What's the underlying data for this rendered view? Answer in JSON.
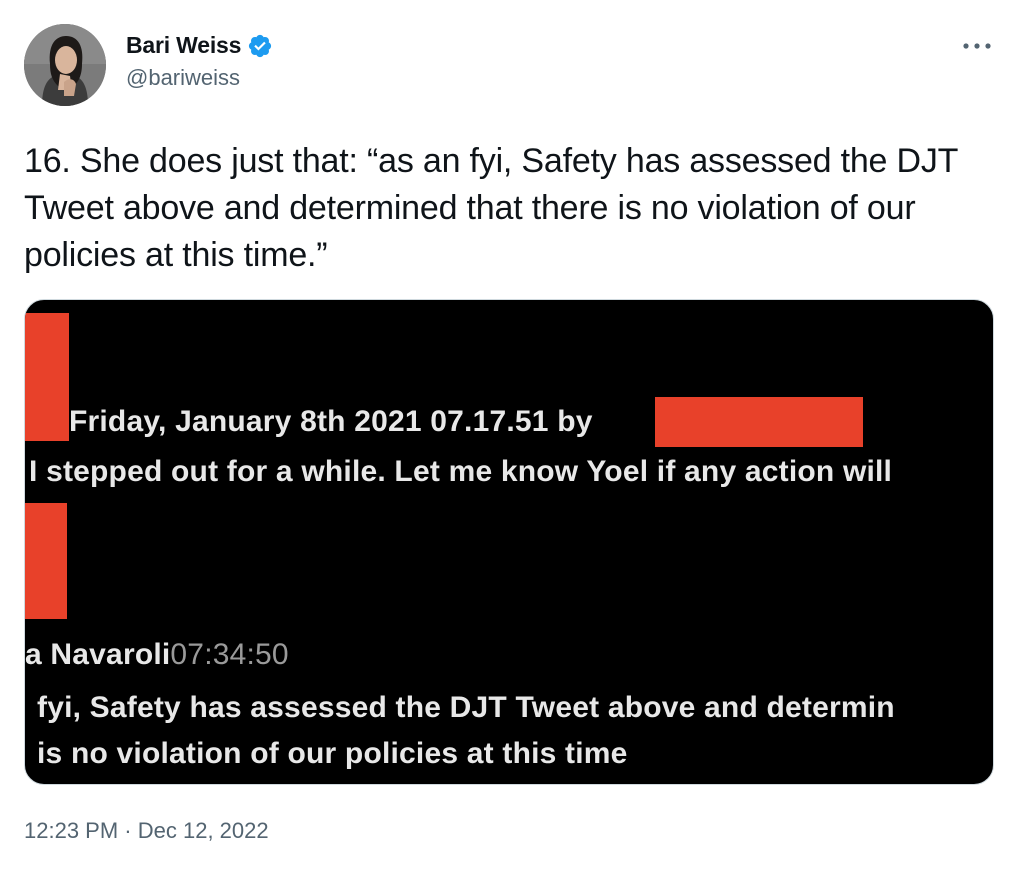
{
  "author": {
    "display_name": "Bari Weiss",
    "handle": "@bariweiss",
    "verified": true
  },
  "icons": {
    "verified": "verified-badge-icon",
    "more": "more-options-icon",
    "avatar": "profile-photo"
  },
  "tweet": {
    "text": "16. She does just that: “as an fyi, Safety has assessed the DJT Tweet above and determined that there is no violation of our policies at this time.”",
    "time": "12:23 PM",
    "separator": "·",
    "date": "Dec 12, 2022"
  },
  "media": {
    "line1": "Friday, January 8th 2021 07.17.51 by",
    "line2": "I stepped out for a while. Let me know Yoel if any action will",
    "line3_name": "a Navaroli",
    "line3_time": "07:34:50",
    "line4": "fyi, Safety has assessed the DJT Tweet above and determin",
    "line5": "is no violation of our policies at this time"
  },
  "colors": {
    "verified_blue": "#1d9bf0",
    "redaction_red": "#e8412a",
    "text_primary": "#0f1419",
    "text_secondary": "#536471"
  }
}
